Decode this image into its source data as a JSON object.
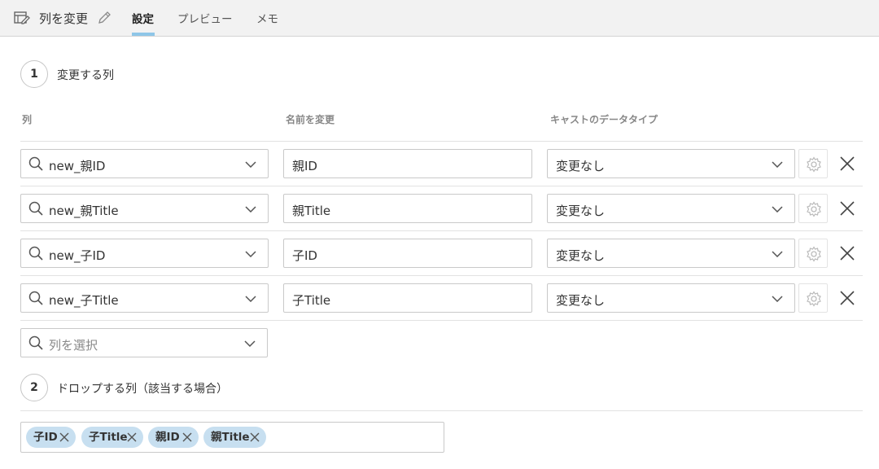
{
  "header": {
    "title": "列を変更",
    "tabs": [
      {
        "label": "設定",
        "active": true
      },
      {
        "label": "プレビュー",
        "active": false
      },
      {
        "label": "メモ",
        "active": false
      }
    ]
  },
  "step1": {
    "number": "1",
    "title": "変更する列",
    "columns": {
      "column": "列",
      "rename": "名前を変更",
      "cast": "キャストのデータタイプ"
    },
    "rows": [
      {
        "column": "new_親ID",
        "rename": "親ID",
        "cast": "変更なし"
      },
      {
        "column": "new_親Title",
        "rename": "親Title",
        "cast": "変更なし"
      },
      {
        "column": "new_子ID",
        "rename": "子ID",
        "cast": "変更なし"
      },
      {
        "column": "new_子Title",
        "rename": "子Title",
        "cast": "変更なし"
      }
    ],
    "select_placeholder": "列を選択"
  },
  "step2": {
    "number": "2",
    "title": "ドロップする列（該当する場合）",
    "tags": [
      "子ID",
      "子Title",
      "親ID",
      "親Title"
    ]
  },
  "colors": {
    "tab_underline": "#8ec6e8",
    "tag_background": "#c7dff0"
  }
}
